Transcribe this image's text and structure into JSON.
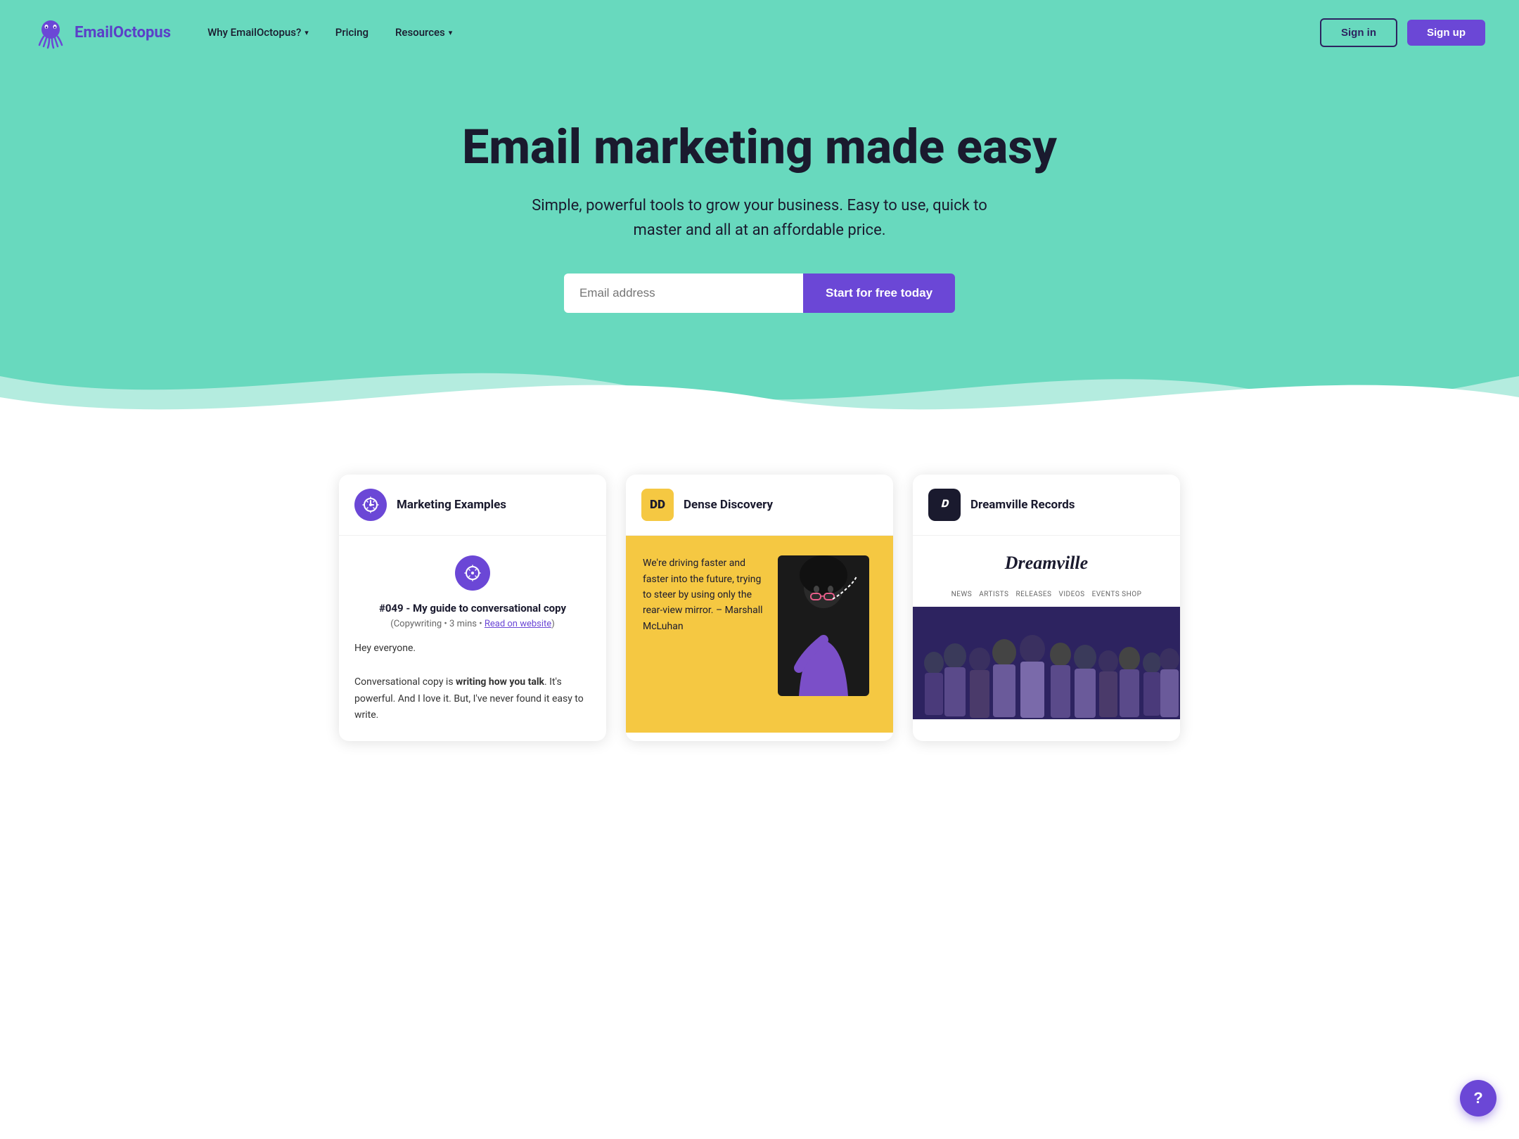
{
  "brand": {
    "name": "EmailOctopus",
    "logo_alt": "EmailOctopus logo"
  },
  "nav": {
    "link1_label": "Why EmailOctopus?",
    "link2_label": "Pricing",
    "link3_label": "Resources",
    "signin_label": "Sign in",
    "signup_label": "Sign up"
  },
  "hero": {
    "title": "Email marketing made easy",
    "subtitle": "Simple, powerful tools to grow your business. Easy to use, quick to master and all at an affordable price.",
    "input_placeholder": "Email address",
    "cta_label": "Start for free today"
  },
  "cards": [
    {
      "id": "marketing-examples",
      "logo_text": "💡",
      "title": "Marketing Examples",
      "post_title": "#049 - My guide to conversational copy",
      "post_meta": "(Copywriting • 3 mins • Read on website)",
      "post_body_line1": "Hey everyone.",
      "post_body_line2": "Conversational copy is writing how you talk. It's powerful. And I love it. But, I've never found it easy to write."
    },
    {
      "id": "dense-discovery",
      "logo_text": "DD",
      "title": "Dense Discovery",
      "quote": "We're driving faster and faster into the future, trying to steer by using only the rear-view mirror. – Marshall McLuhan"
    },
    {
      "id": "dreamville-records",
      "logo_text": "𝔻",
      "title": "Dreamville Records",
      "logo_script": "Dreamville",
      "subnav": [
        "NEWS",
        "ARTISTS",
        "RELEASES",
        "VIDEOS",
        "EVENTS SHOP"
      ]
    }
  ],
  "help": {
    "label": "?"
  }
}
